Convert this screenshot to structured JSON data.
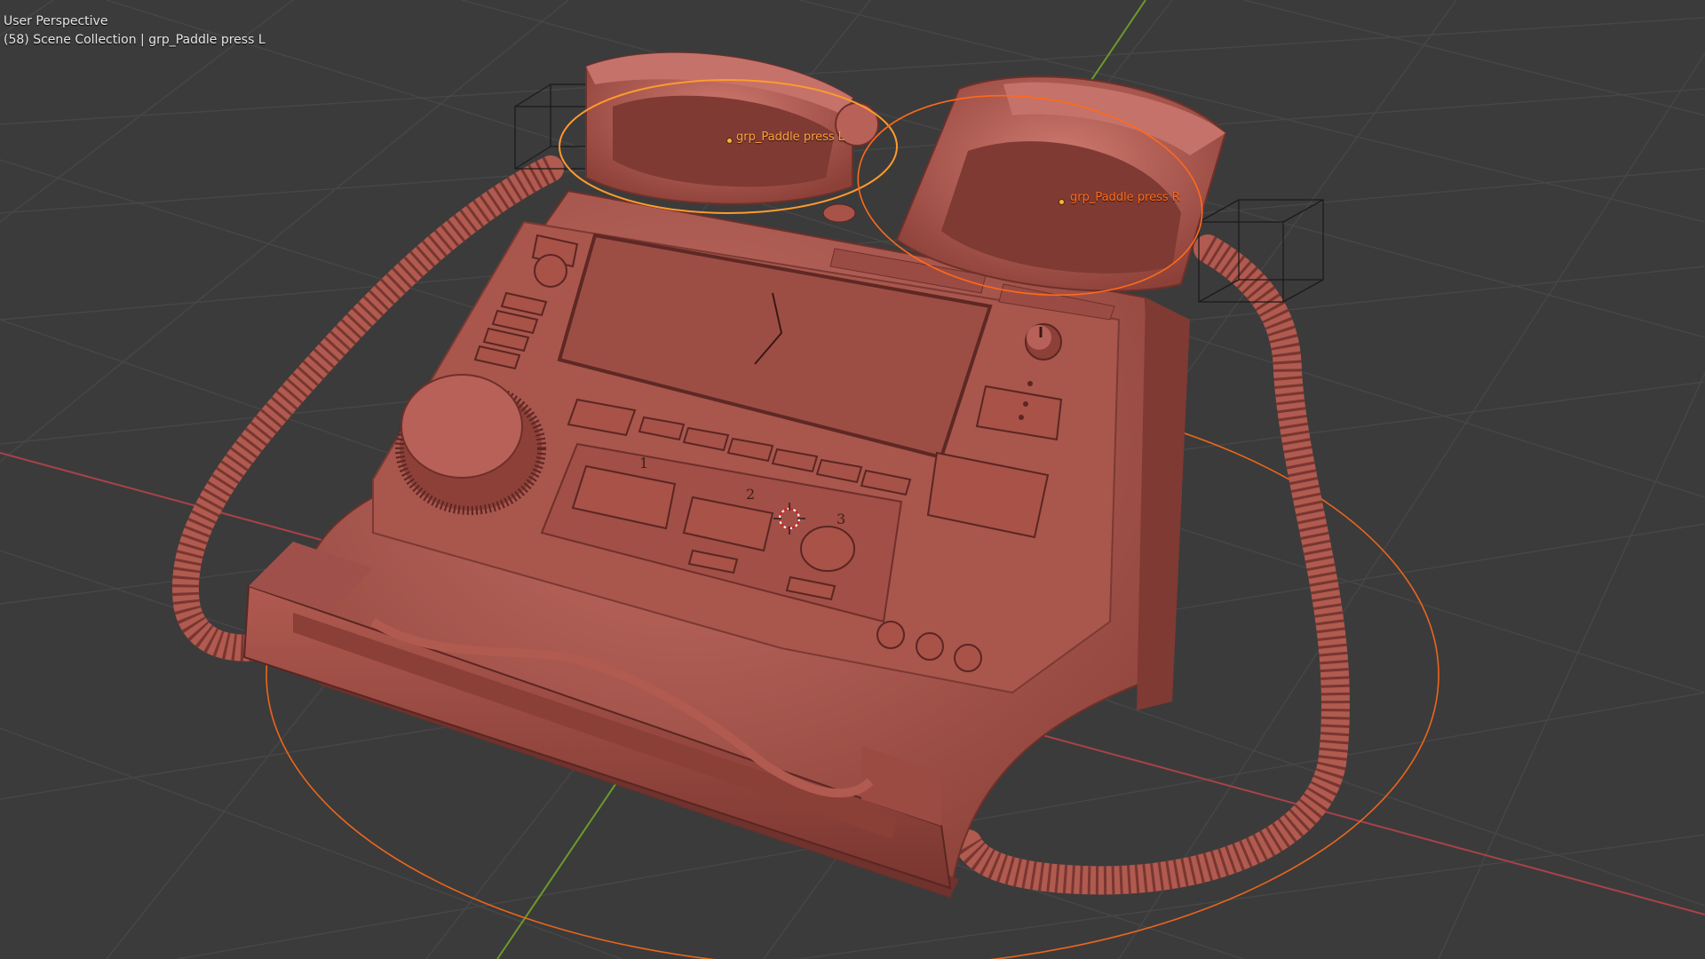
{
  "viewport": {
    "view_name": "User Perspective",
    "collection_line": "(58) Scene Collection | grp_Paddle press L"
  },
  "objects": [
    {
      "name": "grp_Paddle press L",
      "color": "#ff9a2e"
    },
    {
      "name": "grp_Paddle press R",
      "color": "#ff6a1a"
    }
  ],
  "panel_numbers": [
    "1",
    "2",
    "3"
  ],
  "colors": {
    "background": "#3b3b3b",
    "grid": "#4a4a4a",
    "x_axis": "#a8424a",
    "y_axis": "#6c9a2a",
    "model": "#b6625a",
    "selection": "#ff7a1e"
  },
  "icons": [
    "cursor-3d-icon"
  ]
}
